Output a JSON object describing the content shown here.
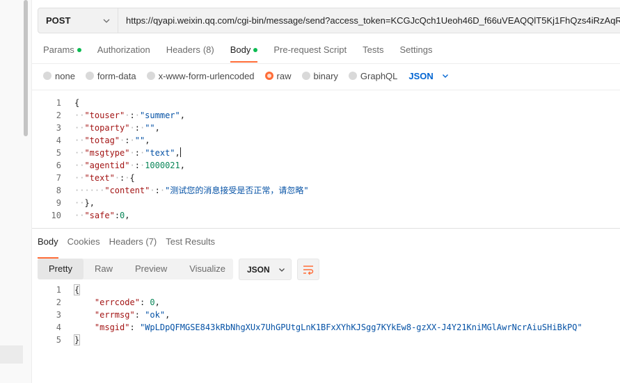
{
  "request": {
    "method": "POST",
    "url": "https://qyapi.weixin.qq.com/cgi-bin/message/send?access_token=KCGJcQch1Ueoh46D_f66uVEAQQlT5Kj1FhQzs4iRzAqRPzT",
    "tabs": [
      {
        "label": "Params",
        "dot": true,
        "count": ""
      },
      {
        "label": "Authorization",
        "dot": false,
        "count": ""
      },
      {
        "label": "Headers",
        "dot": false,
        "count": "(8)"
      },
      {
        "label": "Body",
        "dot": true,
        "count": ""
      },
      {
        "label": "Pre-request Script",
        "dot": false,
        "count": ""
      },
      {
        "label": "Tests",
        "dot": false,
        "count": ""
      },
      {
        "label": "Settings",
        "dot": false,
        "count": ""
      }
    ],
    "active_tab": "Body",
    "body_types": [
      "none",
      "form-data",
      "x-www-form-urlencoded",
      "raw",
      "binary",
      "GraphQL"
    ],
    "selected_body_type": "raw",
    "language": "JSON",
    "body_lines": [
      "{",
      "  \"touser\" : \"summer\",",
      "  \"toparty\" : \"\",",
      "  \"totag\" : \"\",",
      "  \"msgtype\" : \"text\",",
      "  \"agentid\" : 1000021,",
      "  \"text\" : {",
      "      \"content\" : \"测试您的消息接受是否正常，请忽略\"",
      "  },",
      "  \"safe\":0,"
    ]
  },
  "response": {
    "tabs": [
      {
        "label": "Body",
        "count": ""
      },
      {
        "label": "Cookies",
        "count": ""
      },
      {
        "label": "Headers",
        "count": "(7)"
      },
      {
        "label": "Test Results",
        "count": ""
      }
    ],
    "active_tab": "Body",
    "view_modes": [
      "Pretty",
      "Raw",
      "Preview",
      "Visualize"
    ],
    "active_view_mode": "Pretty",
    "language": "JSON",
    "body_lines": [
      "{",
      "    \"errcode\": 0,",
      "    \"errmsg\": \"ok\",",
      "    \"msgid\": \"WpLDpQFMGSE843kRbNhgXUx7UhGPUtgLnK1BFxXYhKJSgg7KYkEw8-gzXX-J4Y21KniMGlAwrNcrAiuSHiBkPQ\"",
      "}"
    ]
  },
  "icons": {
    "method_dropdown": "chevron-down-icon",
    "language_dropdown": "chevron-down-icon",
    "wrap": "wrap-lines-icon"
  },
  "colors": {
    "accent": "#ff6c37",
    "status_dot": "#0cbb52",
    "link_blue": "#0265d2",
    "json_key": "#a31515",
    "json_string": "#0451a5",
    "json_number": "#098658"
  }
}
